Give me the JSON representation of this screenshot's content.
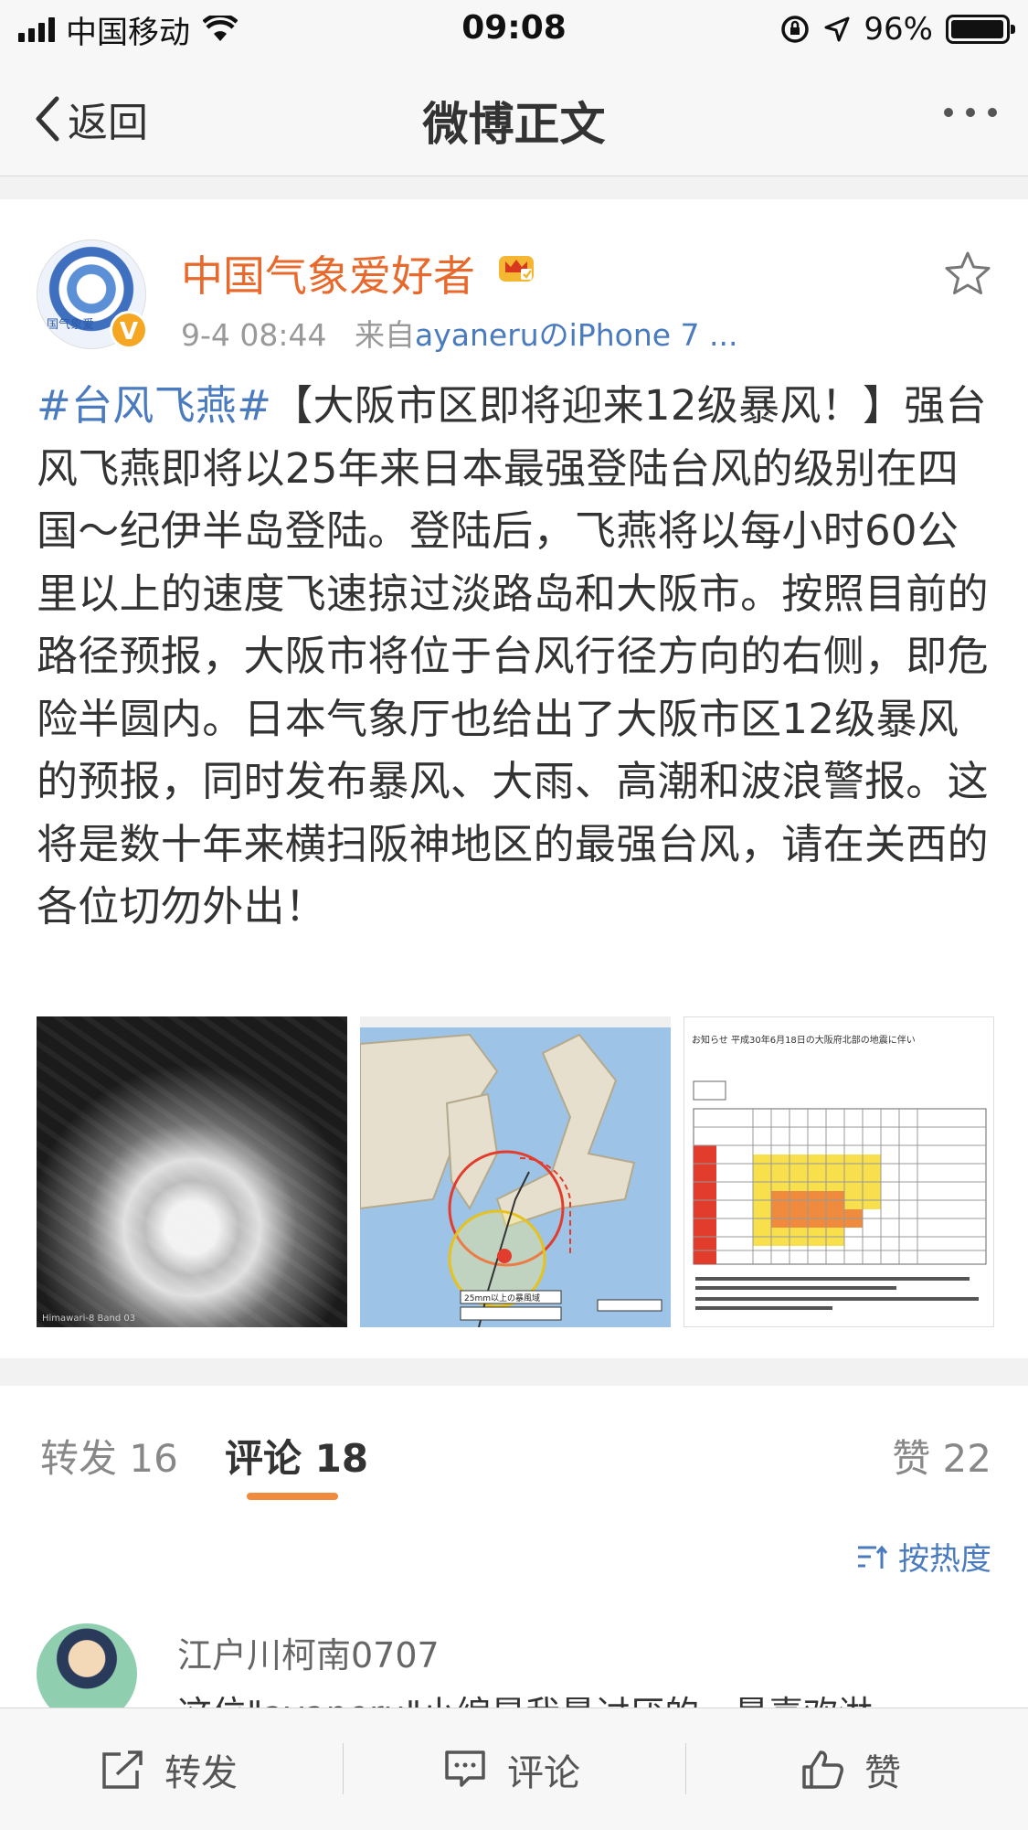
{
  "status_bar": {
    "carrier": "中国移动",
    "time": "09:08",
    "battery": "96%",
    "battery_level": 0.96
  },
  "nav": {
    "back_label": "返回",
    "title": "微博正文"
  },
  "post": {
    "author": "中国气象爱好者",
    "avatar_text": "国气象爱",
    "verified_badge": "V",
    "time": "9-4 08:44",
    "source_prefix": "来自",
    "source": "ayaneruのiPhone 7 ...",
    "hashtag": "#台风飞燕#",
    "body": "【大阪市区即将迎来12级暴风！】强台风飞燕即将以25年来日本最强登陆台风的级别在四国～纪伊半岛登陆。登陆后，飞燕将以每小时60公里以上的速度飞速掠过淡路岛和大阪市。按照目前的路径预报，大阪市将位于台风行径方向的右侧，即危险半圆内。日本气象厅也给出了大阪市区12级暴风的预报，同时发布暴风、大雨、高潮和波浪警报。这将是数十年来横扫阪神地区的最强台风，请在关西的各位切勿外出！",
    "images": [
      {
        "caption": "Himawari-8 Band 03"
      },
      {
        "caption": "25mm以上の暴風域"
      },
      {
        "caption": "お知らせ 平成30年6月18日の大阪府北部の地震に伴い"
      }
    ]
  },
  "tabs": {
    "repost": "转发 16",
    "comment": "评论 18",
    "like": "赞 22"
  },
  "sort_label": "按热度",
  "comment": {
    "user": "江户川柯南0707",
    "text": "这位\"ayaneru\"小编是我最讨厌的，最喜欢淋"
  },
  "toolbar": {
    "repost": "转发",
    "comment": "评论",
    "like": "赞"
  }
}
